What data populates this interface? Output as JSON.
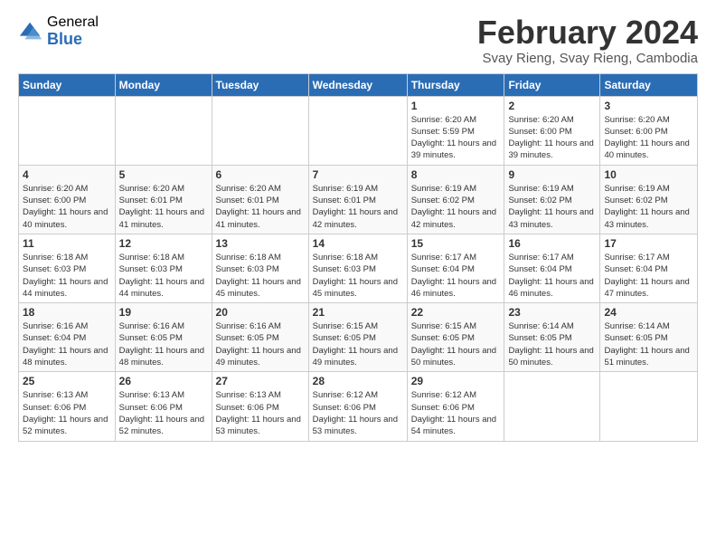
{
  "logo": {
    "general": "General",
    "blue": "Blue"
  },
  "header": {
    "month": "February 2024",
    "location": "Svay Rieng, Svay Rieng, Cambodia"
  },
  "weekdays": [
    "Sunday",
    "Monday",
    "Tuesday",
    "Wednesday",
    "Thursday",
    "Friday",
    "Saturday"
  ],
  "weeks": [
    [
      {
        "date": "",
        "info": ""
      },
      {
        "date": "",
        "info": ""
      },
      {
        "date": "",
        "info": ""
      },
      {
        "date": "",
        "info": ""
      },
      {
        "date": "1",
        "info": "Sunrise: 6:20 AM\nSunset: 5:59 PM\nDaylight: 11 hours and 39 minutes."
      },
      {
        "date": "2",
        "info": "Sunrise: 6:20 AM\nSunset: 6:00 PM\nDaylight: 11 hours and 39 minutes."
      },
      {
        "date": "3",
        "info": "Sunrise: 6:20 AM\nSunset: 6:00 PM\nDaylight: 11 hours and 40 minutes."
      }
    ],
    [
      {
        "date": "4",
        "info": "Sunrise: 6:20 AM\nSunset: 6:00 PM\nDaylight: 11 hours and 40 minutes."
      },
      {
        "date": "5",
        "info": "Sunrise: 6:20 AM\nSunset: 6:01 PM\nDaylight: 11 hours and 41 minutes."
      },
      {
        "date": "6",
        "info": "Sunrise: 6:20 AM\nSunset: 6:01 PM\nDaylight: 11 hours and 41 minutes."
      },
      {
        "date": "7",
        "info": "Sunrise: 6:19 AM\nSunset: 6:01 PM\nDaylight: 11 hours and 42 minutes."
      },
      {
        "date": "8",
        "info": "Sunrise: 6:19 AM\nSunset: 6:02 PM\nDaylight: 11 hours and 42 minutes."
      },
      {
        "date": "9",
        "info": "Sunrise: 6:19 AM\nSunset: 6:02 PM\nDaylight: 11 hours and 43 minutes."
      },
      {
        "date": "10",
        "info": "Sunrise: 6:19 AM\nSunset: 6:02 PM\nDaylight: 11 hours and 43 minutes."
      }
    ],
    [
      {
        "date": "11",
        "info": "Sunrise: 6:18 AM\nSunset: 6:03 PM\nDaylight: 11 hours and 44 minutes."
      },
      {
        "date": "12",
        "info": "Sunrise: 6:18 AM\nSunset: 6:03 PM\nDaylight: 11 hours and 44 minutes."
      },
      {
        "date": "13",
        "info": "Sunrise: 6:18 AM\nSunset: 6:03 PM\nDaylight: 11 hours and 45 minutes."
      },
      {
        "date": "14",
        "info": "Sunrise: 6:18 AM\nSunset: 6:03 PM\nDaylight: 11 hours and 45 minutes."
      },
      {
        "date": "15",
        "info": "Sunrise: 6:17 AM\nSunset: 6:04 PM\nDaylight: 11 hours and 46 minutes."
      },
      {
        "date": "16",
        "info": "Sunrise: 6:17 AM\nSunset: 6:04 PM\nDaylight: 11 hours and 46 minutes."
      },
      {
        "date": "17",
        "info": "Sunrise: 6:17 AM\nSunset: 6:04 PM\nDaylight: 11 hours and 47 minutes."
      }
    ],
    [
      {
        "date": "18",
        "info": "Sunrise: 6:16 AM\nSunset: 6:04 PM\nDaylight: 11 hours and 48 minutes."
      },
      {
        "date": "19",
        "info": "Sunrise: 6:16 AM\nSunset: 6:05 PM\nDaylight: 11 hours and 48 minutes."
      },
      {
        "date": "20",
        "info": "Sunrise: 6:16 AM\nSunset: 6:05 PM\nDaylight: 11 hours and 49 minutes."
      },
      {
        "date": "21",
        "info": "Sunrise: 6:15 AM\nSunset: 6:05 PM\nDaylight: 11 hours and 49 minutes."
      },
      {
        "date": "22",
        "info": "Sunrise: 6:15 AM\nSunset: 6:05 PM\nDaylight: 11 hours and 50 minutes."
      },
      {
        "date": "23",
        "info": "Sunrise: 6:14 AM\nSunset: 6:05 PM\nDaylight: 11 hours and 50 minutes."
      },
      {
        "date": "24",
        "info": "Sunrise: 6:14 AM\nSunset: 6:05 PM\nDaylight: 11 hours and 51 minutes."
      }
    ],
    [
      {
        "date": "25",
        "info": "Sunrise: 6:13 AM\nSunset: 6:06 PM\nDaylight: 11 hours and 52 minutes."
      },
      {
        "date": "26",
        "info": "Sunrise: 6:13 AM\nSunset: 6:06 PM\nDaylight: 11 hours and 52 minutes."
      },
      {
        "date": "27",
        "info": "Sunrise: 6:13 AM\nSunset: 6:06 PM\nDaylight: 11 hours and 53 minutes."
      },
      {
        "date": "28",
        "info": "Sunrise: 6:12 AM\nSunset: 6:06 PM\nDaylight: 11 hours and 53 minutes."
      },
      {
        "date": "29",
        "info": "Sunrise: 6:12 AM\nSunset: 6:06 PM\nDaylight: 11 hours and 54 minutes."
      },
      {
        "date": "",
        "info": ""
      },
      {
        "date": "",
        "info": ""
      }
    ]
  ]
}
